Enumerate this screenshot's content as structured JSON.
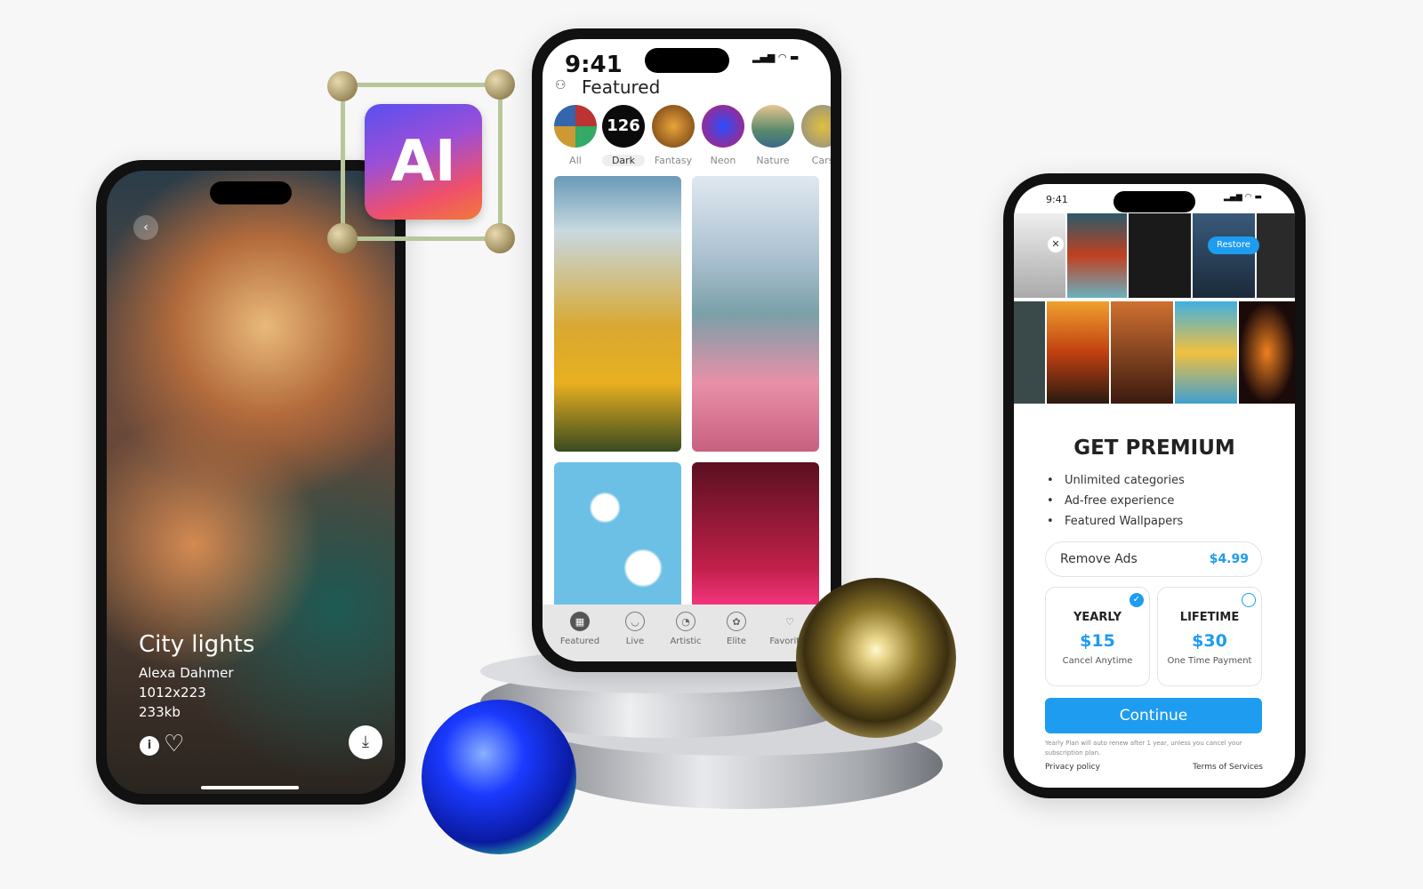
{
  "left_phone": {
    "title": "City lights",
    "author": "Alexa Dahmer",
    "resolution": "1012x223",
    "size": "233kb",
    "icons": [
      "back-icon",
      "info-icon",
      "heart-icon",
      "download-icon"
    ]
  },
  "ai_badge": {
    "text": "AI"
  },
  "middle_phone": {
    "time": "9:41",
    "header": "Featured",
    "categories": [
      {
        "label": "All"
      },
      {
        "label": "Dark",
        "count": "126"
      },
      {
        "label": "Fantasy"
      },
      {
        "label": "Neon"
      },
      {
        "label": "Nature"
      },
      {
        "label": "Cars"
      }
    ],
    "selected_category": "Dark",
    "nav": [
      {
        "label": "Featured",
        "icon": "grid-icon"
      },
      {
        "label": "Live",
        "icon": "live-icon"
      },
      {
        "label": "Artistic",
        "icon": "palette-icon"
      },
      {
        "label": "Elite",
        "icon": "badge-icon"
      },
      {
        "label": "Favorites",
        "icon": "heart-icon"
      }
    ]
  },
  "right_phone": {
    "time": "9:41",
    "restore": "Restore",
    "title": "GET PREMIUM",
    "benefits": [
      "Unlimited categories",
      "Ad-free experience",
      "Featured Wallpapers"
    ],
    "remove_ads": {
      "label": "Remove Ads",
      "price": "$4.99"
    },
    "plans": [
      {
        "name": "YEARLY",
        "price": "$15",
        "note": "Cancel Anytime",
        "selected": true
      },
      {
        "name": "LIFETIME",
        "price": "$30",
        "note": "One Time Payment",
        "selected": false
      }
    ],
    "continue": "Continue",
    "disclaimer": "Yearly Plan will auto renew after 1 year, unless you cancel your subscription plan.",
    "privacy": "Privacy policy",
    "terms": "Terms of Services",
    "accent": "#1e9cf0"
  }
}
